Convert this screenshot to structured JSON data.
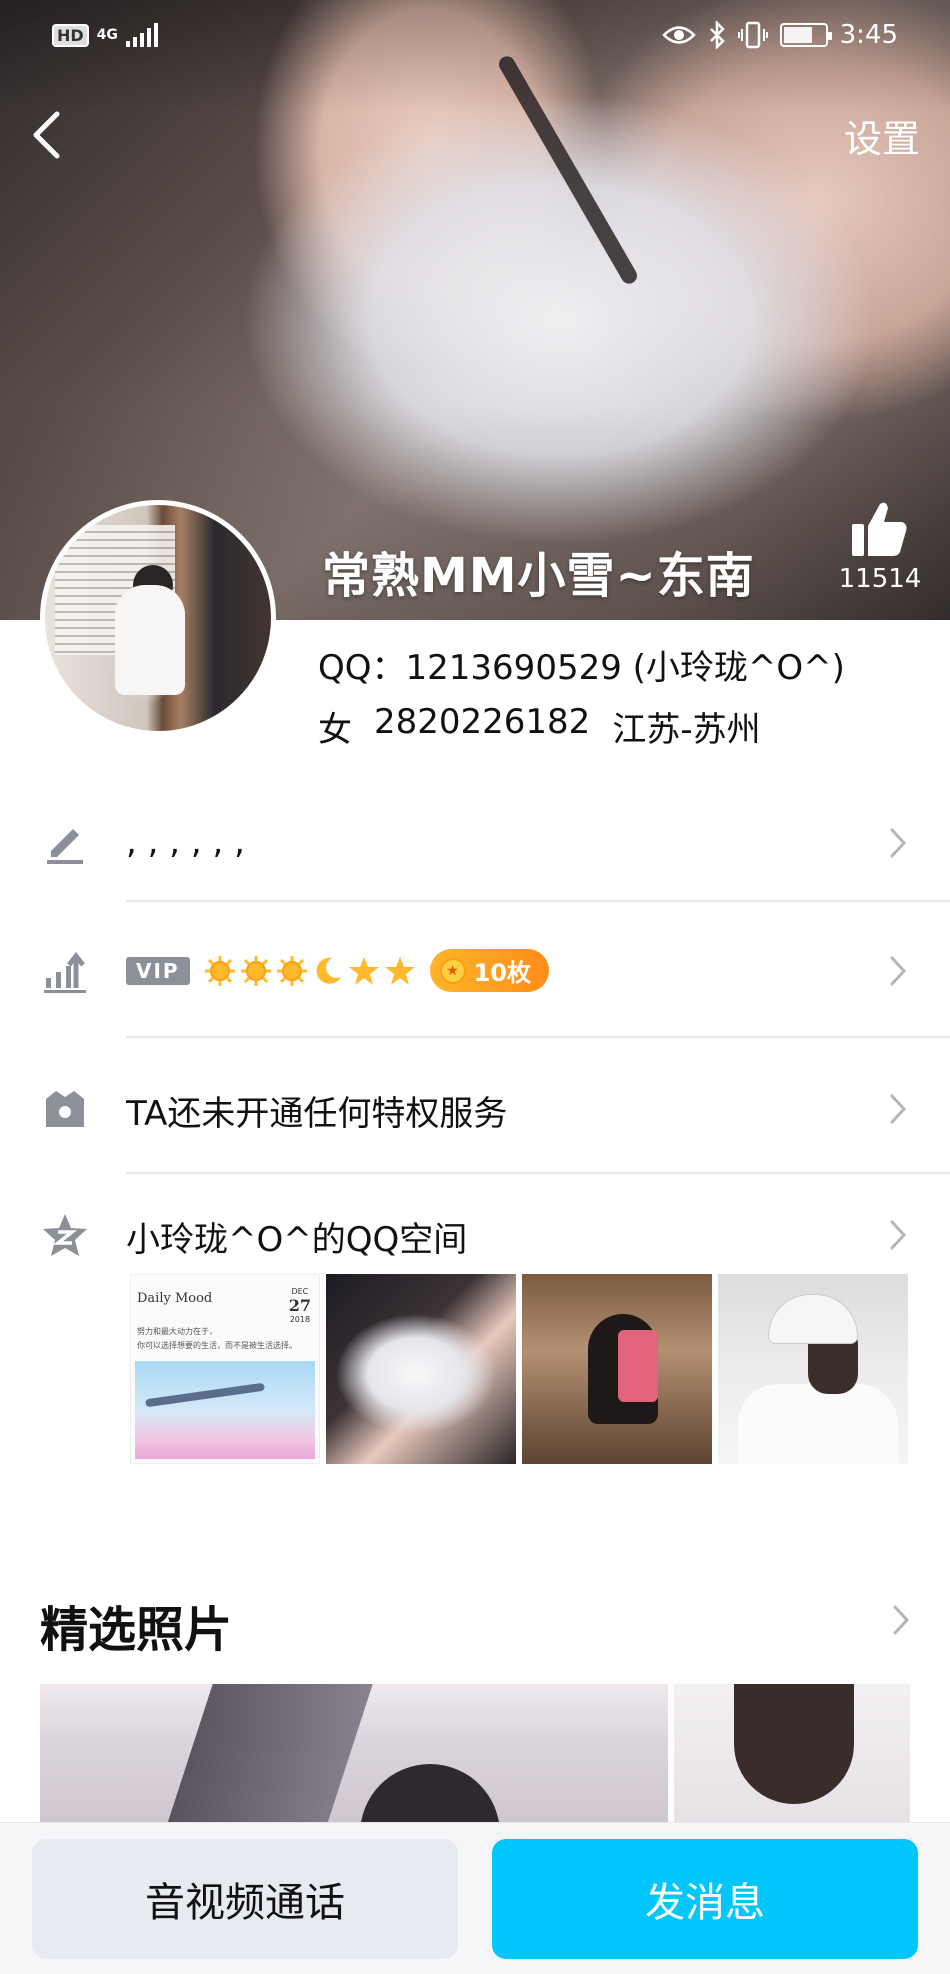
{
  "status_bar": {
    "hd": "HD",
    "network": "4G",
    "time": "3:45"
  },
  "nav": {
    "settings_label": "设置"
  },
  "profile": {
    "name": "常熟MM小雪~东南",
    "like_count": "11514",
    "qq_line": "QQ：1213690529 (小玲珑^O^)",
    "gender": "女",
    "account_number": "2820226182",
    "location": "江苏-苏州"
  },
  "rows": {
    "signature": ", , , , , ,",
    "vip_tag": "VIP",
    "medal_count": "10枚",
    "privilege": "TA还未开通任何特权服务",
    "qzone": "小玲珑^O^的QQ空间"
  },
  "qzone_thumb": {
    "title": "Daily Mood",
    "month": "DEC",
    "day": "27",
    "year": "2018",
    "line1": "努力和最大动力在于，",
    "line2": "你可以选择想要的生活，而不是被生活选择。"
  },
  "section": {
    "featured_photos": "精选照片"
  },
  "actions": {
    "call_label": "音视频通话",
    "message_label": "发消息"
  },
  "colors": {
    "accent": "#00c6fb",
    "secondary_button": "#e8eaf2",
    "icon_gray": "#8d8f99",
    "medal_orange": "#ff9d10"
  },
  "icons": {
    "back": "chevron-left-icon",
    "like": "thumbs-up-icon",
    "signature": "pen-icon",
    "level": "level-up-icon",
    "privilege": "crown-bag-icon",
    "qzone": "star-z-icon",
    "chevron": "chevron-right-icon"
  }
}
